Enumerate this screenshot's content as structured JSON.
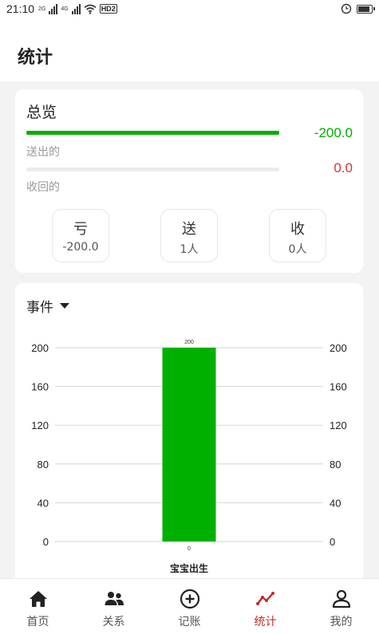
{
  "status_bar": {
    "time": "21:10",
    "network_1": "2G",
    "network_2": "4G",
    "hd": "HD",
    "hd2": "2"
  },
  "header": {
    "title": "统计"
  },
  "overview": {
    "title": "总览",
    "sent": {
      "label": "送出的",
      "value": "-200.0",
      "fill_fraction": 1.0,
      "color": "#00b000"
    },
    "received": {
      "label": "收回的",
      "value": "0.0",
      "fill_fraction": 0.0,
      "color": "#e03030"
    },
    "stats": [
      {
        "title": "亏",
        "value": "-200.0"
      },
      {
        "title": "送",
        "value": "1人"
      },
      {
        "title": "收",
        "value": "0人"
      }
    ]
  },
  "events": {
    "filter_label": "事件"
  },
  "chart_data": {
    "type": "bar",
    "categories": [
      "宝宝出生"
    ],
    "series": [
      {
        "values": [
          200
        ],
        "color": "#00b000"
      },
      {
        "values": [
          0
        ],
        "color": "#e03030"
      }
    ],
    "data_labels": [
      "200",
      "0"
    ],
    "y_ticks": [
      "0",
      "40",
      "80",
      "120",
      "160",
      "200"
    ],
    "ylim": [
      0,
      200
    ],
    "grid": true,
    "dual_axis": true
  },
  "tabs": [
    {
      "label": "首页",
      "icon": "home-icon",
      "active": false
    },
    {
      "label": "关系",
      "icon": "people-icon",
      "active": false
    },
    {
      "label": "记账",
      "icon": "add-circle-icon",
      "active": false
    },
    {
      "label": "统计",
      "icon": "stats-line-icon",
      "active": true
    },
    {
      "label": "我的",
      "icon": "profile-icon",
      "active": false
    }
  ],
  "colors": {
    "accent": "#c62828",
    "green": "#00b000",
    "red": "#e03030"
  }
}
